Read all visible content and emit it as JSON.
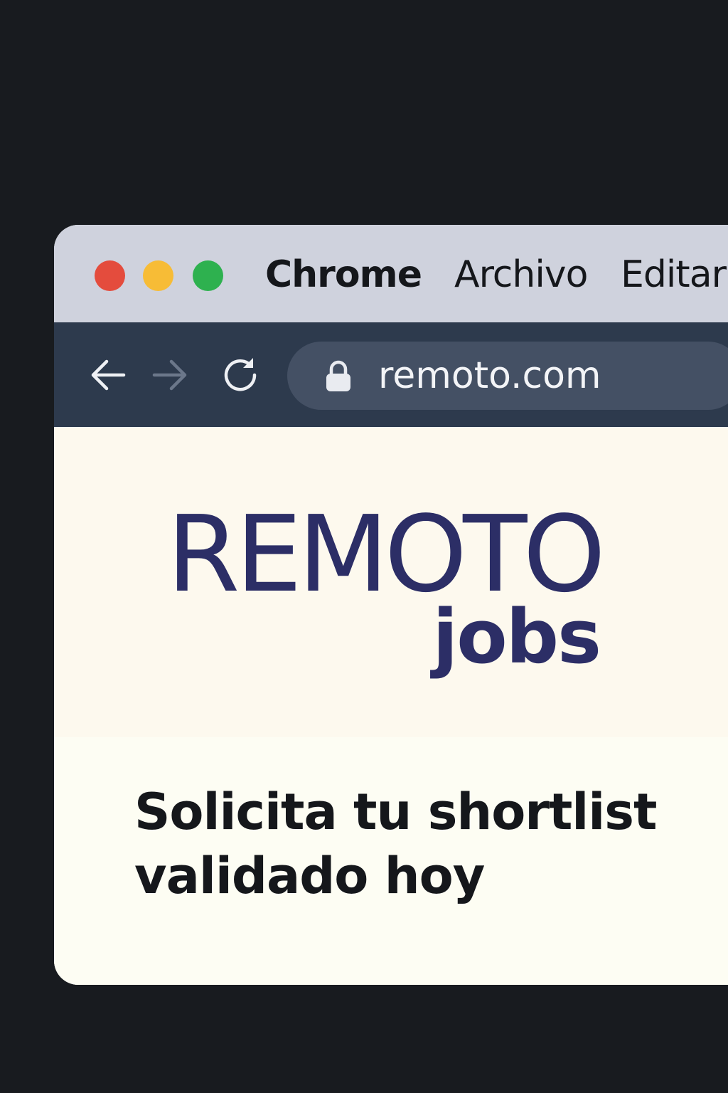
{
  "menubar": {
    "app_name": "Chrome",
    "items": [
      "Archivo",
      "Editar"
    ]
  },
  "toolbar": {
    "back_icon": "arrow-left-icon",
    "forward_icon": "arrow-right-icon",
    "reload_icon": "reload-icon",
    "lock_icon": "lock-icon",
    "url": "remoto.com"
  },
  "page": {
    "logo_main": "REMOTO",
    "logo_sub": "jobs",
    "heading_line1": "Solicita tu shortlist",
    "heading_line2": "validado hoy"
  },
  "colors": {
    "traffic_red": "#e44c3d",
    "traffic_yellow": "#f7bc36",
    "traffic_green": "#2eb14f",
    "brand": "#2c2e66",
    "toolbar_bg": "#2d3a4d",
    "page_bg": "#fdf9ee"
  }
}
